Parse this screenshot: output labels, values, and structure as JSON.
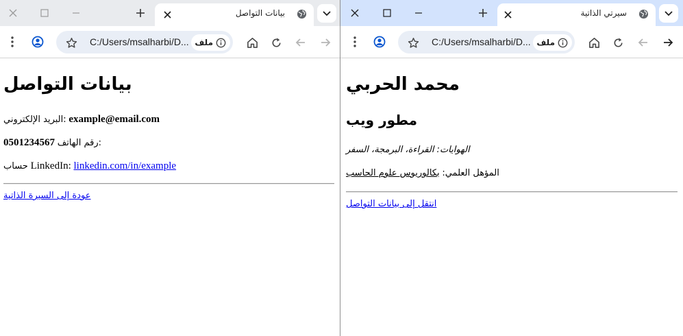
{
  "left_window": {
    "tab": {
      "title": "بيانات التواصل"
    },
    "address_bar": {
      "url": "C:/Users/msalharbi/D...",
      "chip_label": "ملف"
    },
    "page": {
      "heading": "بيانات التواصل",
      "email_label": "البريد الإلكتروني:",
      "email_value": "example@email.com",
      "phone_label": "رقم الهاتف:",
      "phone_value": "0501234567",
      "linkedin_prefix": "حساب",
      "linkedin_label": "LinkedIn:",
      "linkedin_link": "linkedin.com/in/example",
      "back_link": "عودة إلى السيرة الذاتية"
    }
  },
  "right_window": {
    "tab": {
      "title": "سيرتي الذاتية"
    },
    "address_bar": {
      "url": "C:/Users/msalharbi/D...",
      "chip_label": "ملف"
    },
    "page": {
      "heading": "محمد الحربي",
      "subheading": "مطور ويب",
      "hobbies": "الهوايات: القراءة، البرمجة، السفر",
      "qualification_label": "المؤهل العلمي:",
      "qualification_value": "بكالوريوس علوم الحاسب",
      "contact_link": "انتقل إلى بيانات التواصل"
    }
  },
  "icons": [
    "close-icon",
    "maximize-icon",
    "minimize-icon",
    "new-tab-icon",
    "tab-close-icon",
    "globe-icon",
    "tab-search-icon",
    "menu-icon",
    "profile-icon",
    "star-icon",
    "info-icon",
    "home-icon",
    "reload-icon",
    "back-icon",
    "forward-icon"
  ],
  "colors": {
    "left_tabstrip": "#e9ebee",
    "right_tabstrip": "#d3e3fd",
    "omnibox": "#e9eef6",
    "link": "#0000ee",
    "profile": "#0b57d0"
  }
}
